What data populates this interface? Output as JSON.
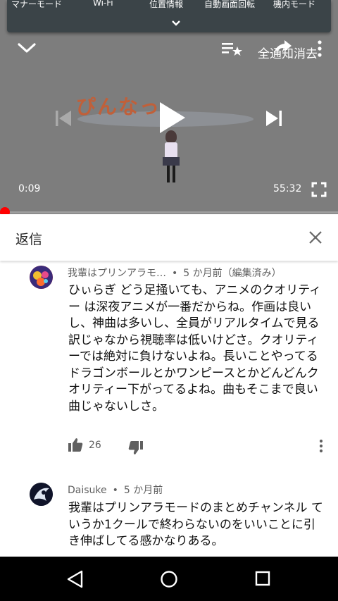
{
  "status_bar": {
    "quick_settings": [
      "マナーモード",
      "Wi-Fi",
      "位置情報",
      "自動画面回転",
      "機内モード"
    ]
  },
  "player": {
    "thumbnail_title": "ぴんなっ",
    "clear_all_label": "全通知消去",
    "current_time": "0:09",
    "duration": "55:32",
    "progress_fraction": 0.003,
    "icons": {
      "minimize": "chevron-down-icon",
      "add_to_playlist": "playlist-add-icon",
      "share": "share-icon",
      "more": "more-vertical-icon",
      "previous": "skip-previous-icon",
      "play": "play-icon",
      "next": "skip-next-icon",
      "fullscreen": "fullscreen-icon"
    }
  },
  "reply_panel": {
    "title": "返信",
    "close_icon": "close-icon"
  },
  "comments": [
    {
      "author": "我輩はプリンアラモ…",
      "time": "5 か月前（編集済み）",
      "text": "ひぃらぎ どう足掻いても、アニメのクオリティー は深夜アニメが一番だからね。作画は良いし、神曲は多いし、全員がリアルタイムで見る訳じゃなから視聴率は低いけどさ。クオリティーでは絶対に負けないよね。長いことやってるドラゴンボールとかワンピースとかどんどんクオリティー下がってるよね。曲もそこまで良い曲じゃないしさ。",
      "likes": "26"
    },
    {
      "author": "Daisuke",
      "time": "5 か月前",
      "text": "我輩はプリンアラモードのまとめチャンネル ていうか1クールで終わらないのをいいことに引き伸ばしてる感かなりある。"
    }
  ],
  "colors": {
    "accent_red": "#ff0000",
    "player_bg": "#7d7d7d",
    "shade_bg": "#3b4448",
    "nav_bg": "#000000"
  }
}
